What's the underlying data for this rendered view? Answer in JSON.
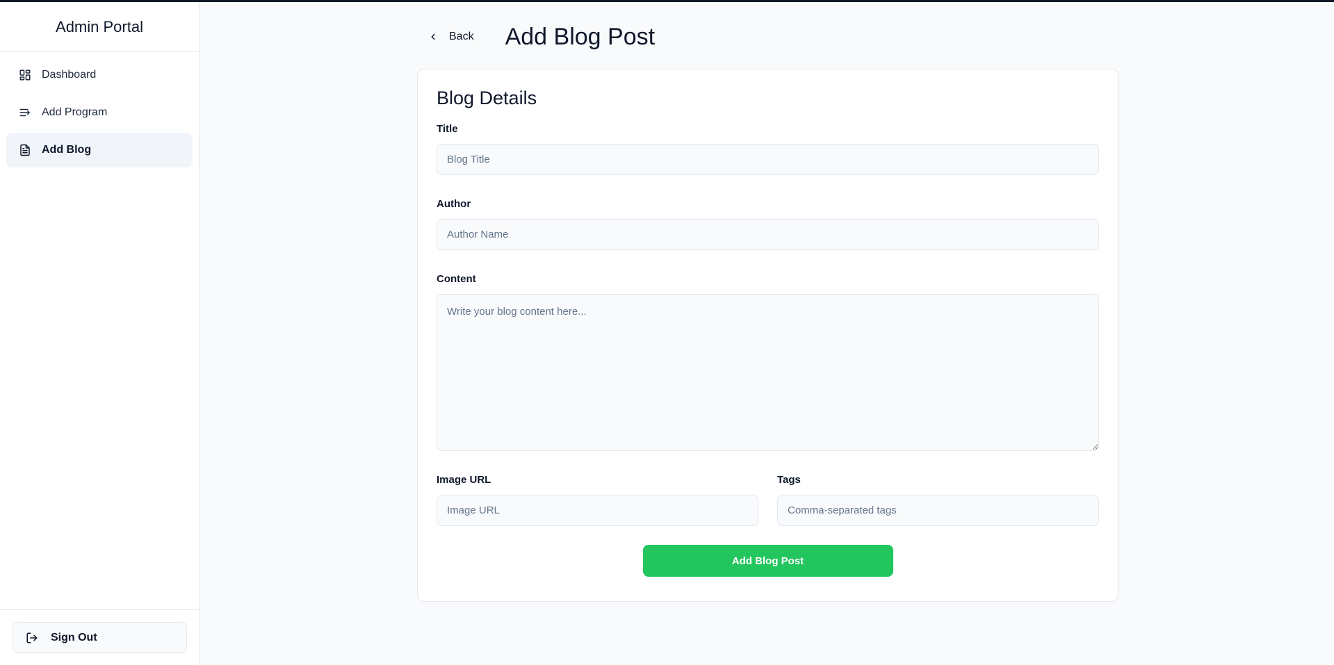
{
  "sidebar": {
    "brand": "Admin Portal",
    "items": [
      {
        "label": "Dashboard",
        "icon": "layout-grid-icon",
        "active": false
      },
      {
        "label": "Add Program",
        "icon": "list-plus-icon",
        "active": false
      },
      {
        "label": "Add Blog",
        "icon": "file-text-icon",
        "active": true
      }
    ],
    "sign_out_label": "Sign Out"
  },
  "header": {
    "back_label": "Back",
    "title": "Add Blog Post"
  },
  "form": {
    "card_title": "Blog Details",
    "title_label": "Title",
    "title_placeholder": "Blog Title",
    "author_label": "Author",
    "author_placeholder": "Author Name",
    "content_label": "Content",
    "content_placeholder": "Write your blog content here...",
    "image_url_label": "Image URL",
    "image_url_placeholder": "Image URL",
    "tags_label": "Tags",
    "tags_placeholder": "Comma-separated tags",
    "submit_label": "Add Blog Post"
  },
  "colors": {
    "accent": "#22c55e",
    "background": "#f8fafc",
    "active_nav": "#f1f5f9"
  }
}
